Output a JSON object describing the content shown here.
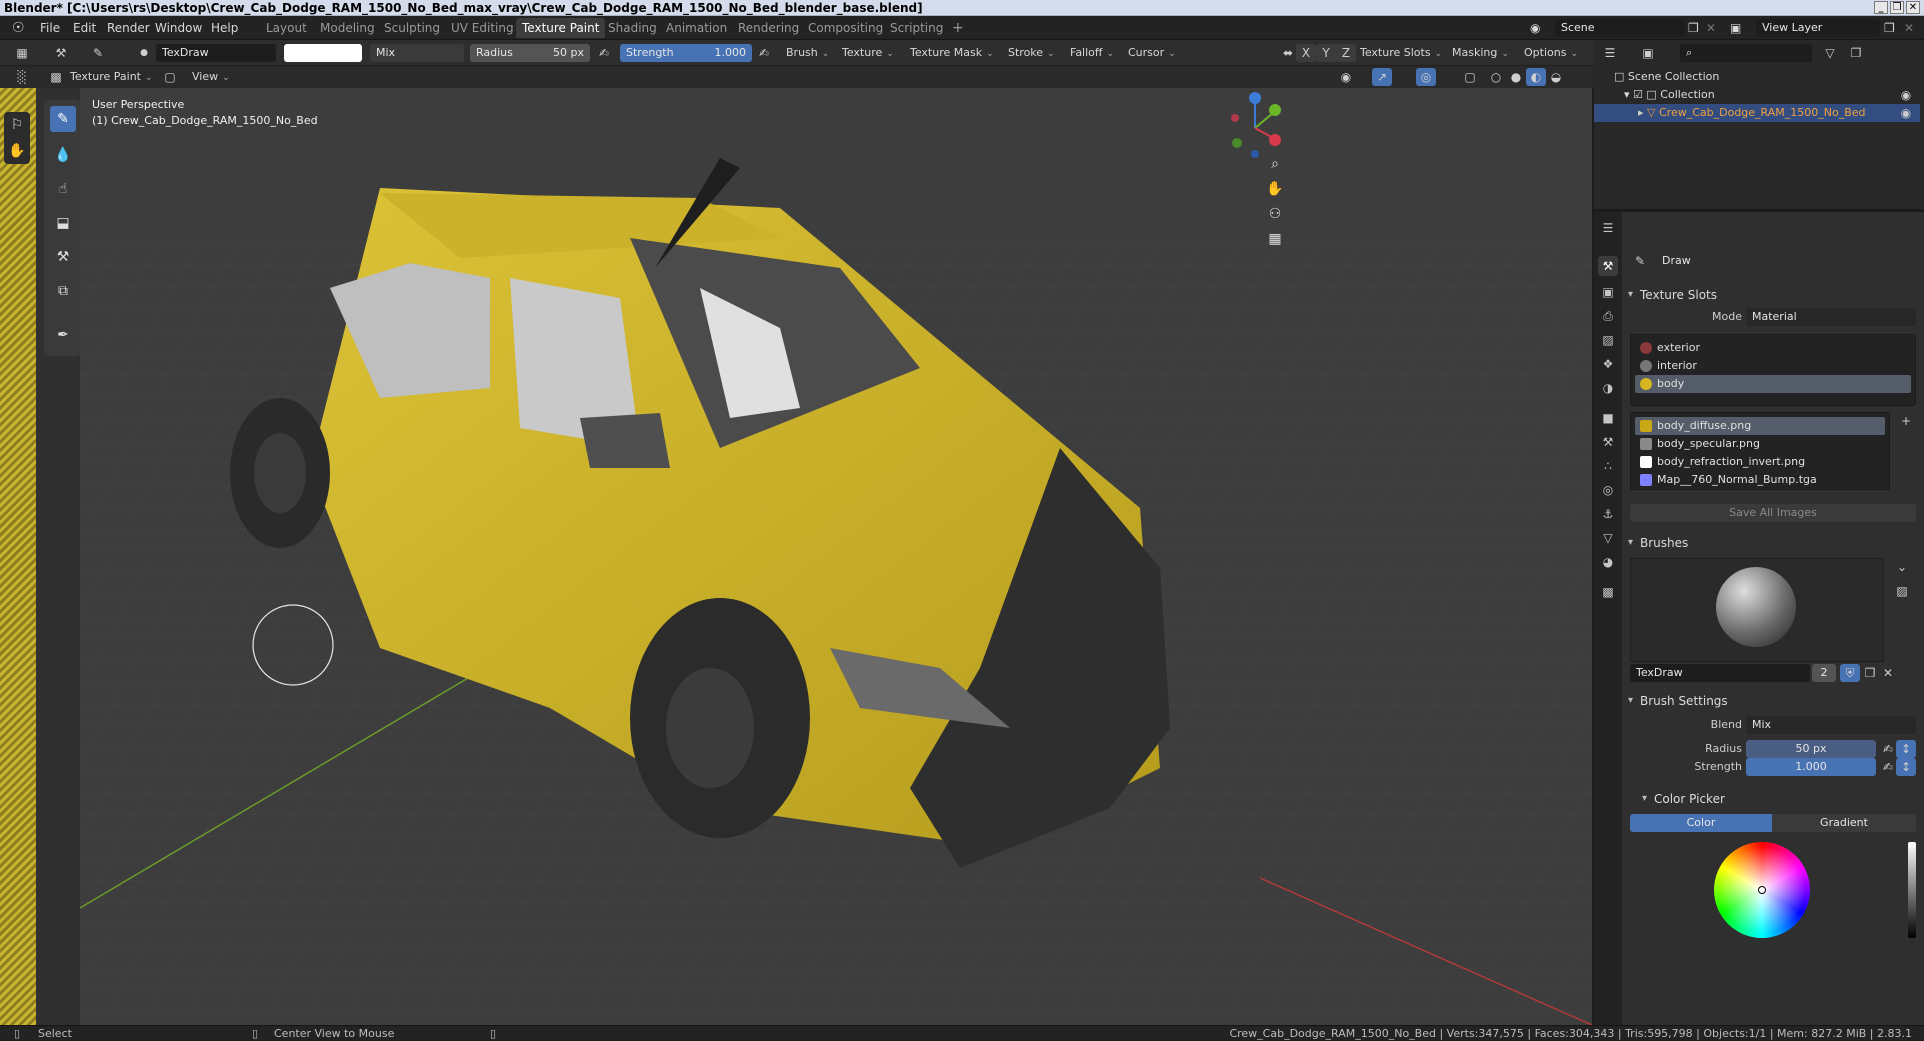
{
  "window": {
    "title": "Blender* [C:\\Users\\rs\\Desktop\\Crew_Cab_Dodge_RAM_1500_No_Bed_max_vray\\Crew_Cab_Dodge_RAM_1500_No_Bed_blender_base.blend]",
    "controls": [
      "_",
      "❒",
      "✕"
    ]
  },
  "menu": {
    "items": [
      "File",
      "Edit",
      "Render",
      "Window",
      "Help"
    ]
  },
  "workspaces": {
    "tabs": [
      "Layout",
      "Modeling",
      "Sculpting",
      "UV Editing",
      "Texture Paint",
      "Shading",
      "Animation",
      "Rendering",
      "Compositing",
      "Scripting"
    ],
    "active": "Texture Paint",
    "add": "+"
  },
  "scene": {
    "label": "Scene",
    "view_layer": "View Layer"
  },
  "tool_header": {
    "brush_name": "TexDraw",
    "color": "#ffffff",
    "blend": "Mix",
    "radius_label": "Radius",
    "radius_value": "50 px",
    "strength_label": "Strength",
    "strength_value": "1.000",
    "strength_fraction": 1.0,
    "menus": [
      "Brush",
      "Texture",
      "Texture Mask",
      "Stroke",
      "Falloff",
      "Cursor"
    ],
    "axes": [
      "X",
      "Y",
      "Z"
    ],
    "right_menus": [
      "Texture Slots",
      "Masking",
      "Options"
    ]
  },
  "view_header": {
    "mode": "Texture Paint",
    "view": "View"
  },
  "viewport": {
    "perspective": "User Perspective",
    "object_label": "(1) Crew_Cab_Dodge_RAM_1500_No_Bed",
    "gizmo_axes": {
      "x": "X",
      "y": "Y",
      "z": "Z"
    },
    "body_color": "#d2b62a"
  },
  "outliner": {
    "search_placeholder": "",
    "scene_collection": "Scene Collection",
    "collection": "Collection",
    "object": "Crew_Cab_Dodge_RAM_1500_No_Bed"
  },
  "properties": {
    "tool_name": "Draw",
    "texture_slots": {
      "title": "Texture Slots",
      "mode_label": "Mode",
      "mode_value": "Material",
      "materials": [
        {
          "name": "exterior",
          "color": "#8a3a3a"
        },
        {
          "name": "interior",
          "color": "#777777"
        },
        {
          "name": "body",
          "color": "#d8b620"
        }
      ],
      "selected_material": "body",
      "images": [
        {
          "name": "body_diffuse.png",
          "color": "#c9a818"
        },
        {
          "name": "body_specular.png",
          "color": "#8a8a8a"
        },
        {
          "name": "body_refraction_invert.png",
          "color": "#ffffff"
        },
        {
          "name": "Map__760_Normal_Bump.tga",
          "color": "#8080ff"
        }
      ],
      "selected_image": "body_diffuse.png",
      "save_button": "Save All Images"
    },
    "brushes": {
      "title": "Brushes",
      "brush_name": "TexDraw",
      "users": "2"
    },
    "brush_settings": {
      "title": "Brush Settings",
      "blend_label": "Blend",
      "blend_value": "Mix",
      "radius_label": "Radius",
      "radius_value": "50 px",
      "strength_label": "Strength",
      "strength_value": "1.000"
    },
    "color_picker": {
      "title": "Color Picker",
      "tab_color": "Color",
      "tab_gradient": "Gradient"
    }
  },
  "statusbar": {
    "select": "Select",
    "center_view": "Center View to Mouse",
    "stats": "Crew_Cab_Dodge_RAM_1500_No_Bed | Verts:347,575 | Faces:304,343 | Tris:595,798 | Objects:1/1 | Mem: 827.2 MiB | 2.83.1"
  }
}
